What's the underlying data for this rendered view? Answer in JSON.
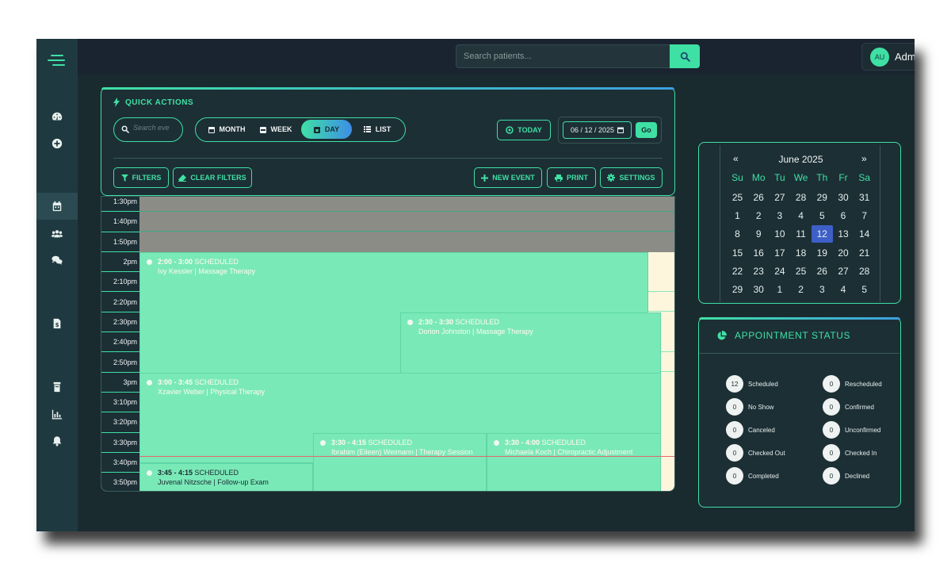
{
  "topbar": {
    "search_placeholder": "Search patients...",
    "admin_initials": "AU",
    "admin_name": "Admin"
  },
  "quick_actions": {
    "title": "QUICK ACTIONS",
    "search_placeholder": "Search eve",
    "views": [
      "MONTH",
      "WEEK",
      "DAY",
      "LIST"
    ],
    "active_view": "DAY",
    "today_label": "TODAY",
    "date_value": "06 / 12 / 2025",
    "go_label": "Go",
    "filters_label": "FILTERS",
    "clear_filters_label": "CLEAR FILTERS",
    "new_event_label": "NEW EVENT",
    "print_label": "PRINT",
    "settings_label": "SETTINGS"
  },
  "schedule": {
    "time_slots": [
      "1:30pm",
      "1:40pm",
      "1:50pm",
      "2pm",
      "2:10pm",
      "2:20pm",
      "2:30pm",
      "2:40pm",
      "2:50pm",
      "3pm",
      "3:10pm",
      "3:20pm",
      "3:30pm",
      "3:40pm",
      "3:50pm"
    ],
    "events": [
      {
        "time": "2:00 - 3:00",
        "status": "SCHEDULED",
        "detail": "Ivy Kessler | Massage Therapy"
      },
      {
        "time": "2:30 - 3:30",
        "status": "SCHEDULED",
        "detail": "Dorion Johnston | Massage Therapy"
      },
      {
        "time": "3:00 - 3:45",
        "status": "SCHEDULED",
        "detail": "Xzavier Weber | Physical Therapy"
      },
      {
        "time": "3:30 - 4:15",
        "status": "SCHEDULED",
        "detail": "Ibrahim (Eileen) Weimann | Therapy Session"
      },
      {
        "time": "3:30 - 4:00",
        "status": "SCHEDULED",
        "detail": "Michaela Koch | Chiropractic Adjustment"
      },
      {
        "time": "3:45 - 4:15",
        "status": "SCHEDULED",
        "detail": "Juvenal Nitzsche | Follow-up Exam"
      }
    ]
  },
  "mini_calendar": {
    "prev": "«",
    "next": "»",
    "month_label": "June 2025",
    "days_of_week": [
      "Su",
      "Mo",
      "Tu",
      "We",
      "Th",
      "Fr",
      "Sa"
    ],
    "weeks": [
      [
        "25",
        "26",
        "27",
        "28",
        "29",
        "30",
        "31"
      ],
      [
        "1",
        "2",
        "3",
        "4",
        "5",
        "6",
        "7"
      ],
      [
        "8",
        "9",
        "10",
        "11",
        "12",
        "13",
        "14"
      ],
      [
        "15",
        "16",
        "17",
        "18",
        "19",
        "20",
        "21"
      ],
      [
        "22",
        "23",
        "24",
        "25",
        "26",
        "27",
        "28"
      ],
      [
        "29",
        "30",
        "1",
        "2",
        "3",
        "4",
        "5"
      ]
    ],
    "selected_day": "12"
  },
  "appointment_status": {
    "title": "APPOINTMENT STATUS",
    "items": [
      {
        "count": "12",
        "label": "Scheduled"
      },
      {
        "count": "0",
        "label": "Rescheduled"
      },
      {
        "count": "0",
        "label": "No Show"
      },
      {
        "count": "0",
        "label": "Confirmed"
      },
      {
        "count": "0",
        "label": "Canceled"
      },
      {
        "count": "0",
        "label": "Unconfirmed"
      },
      {
        "count": "0",
        "label": "Checked Out"
      },
      {
        "count": "0",
        "label": "Checked In"
      },
      {
        "count": "0",
        "label": "Completed"
      },
      {
        "count": "0",
        "label": "Declined"
      }
    ]
  }
}
